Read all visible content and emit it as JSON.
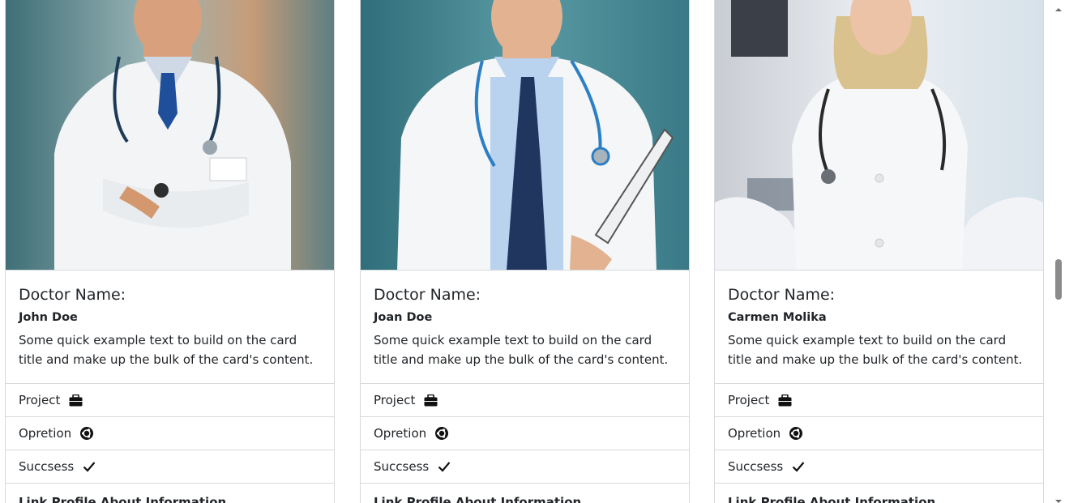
{
  "cards": [
    {
      "title": "Doctor Name:",
      "name": "John Doe",
      "text": "Some quick example text to build on the card title and make up the bulk of the card's content.",
      "items": [
        "Project",
        "Opretion",
        "Succsess"
      ],
      "footer": "Link Profile    About Information"
    },
    {
      "title": "Doctor Name:",
      "name": "Joan Doe",
      "text": "Some quick example text to build on the card title and make up the bulk of the card's content.",
      "items": [
        "Project",
        "Opretion",
        "Succsess"
      ],
      "footer": "Link Profile    About Information"
    },
    {
      "title": "Doctor Name:",
      "name": "Carmen Molika",
      "text": "Some quick example text to build on the card title and make up the bulk of the card's content.",
      "items": [
        "Project",
        "Opretion",
        "Succsess"
      ],
      "footer": "Link Profile    About Information"
    }
  ],
  "icons": {
    "project": "briefcase-icon",
    "operation": "ubuntu-icon",
    "success": "check-icon"
  },
  "colors": {
    "border": "#d7d9dc",
    "text": "#212529",
    "scroll_thumb": "#8b8b8b"
  }
}
